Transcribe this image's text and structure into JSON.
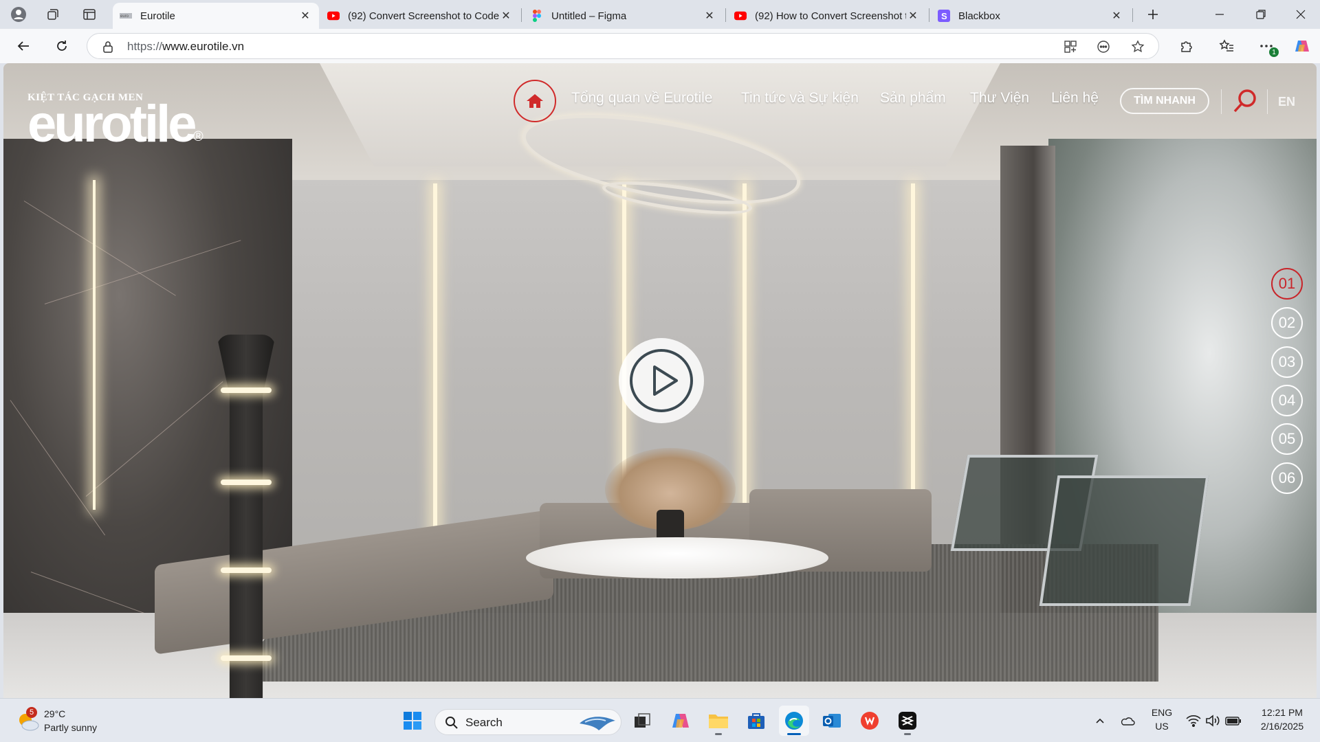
{
  "browser": {
    "tabs": [
      {
        "title": "Eurotile",
        "icon": "eurotile-favicon",
        "active": true
      },
      {
        "title": "(92) Convert Screenshot to Code",
        "icon": "youtube-favicon",
        "active": false
      },
      {
        "title": "Untitled – Figma",
        "icon": "figma-favicon",
        "active": false
      },
      {
        "title": "(92) How to Convert Screenshot t",
        "icon": "youtube-favicon",
        "active": false
      },
      {
        "title": "Blackbox",
        "icon": "blackbox-favicon",
        "active": false
      }
    ],
    "url_scheme": "https://",
    "url_host": "www.eurotile.vn",
    "extension_badge": "1"
  },
  "site": {
    "logo_tagline": "KIỆT TÁC GẠCH MEN",
    "logo_word": "eurotile",
    "logo_reg": "®",
    "nav": [
      {
        "label": "Tổng quan về Eurotile"
      },
      {
        "label": "Tin tức và Sự kiện"
      },
      {
        "label": "Sản phẩm"
      },
      {
        "label": "Thư Viện"
      },
      {
        "label": "Liên hệ"
      }
    ],
    "quick_search": "TÌM NHANH",
    "language": "EN",
    "slides": [
      "01",
      "02",
      "03",
      "04",
      "05",
      "06"
    ],
    "active_slide": "01",
    "accent": "#c8252a"
  },
  "taskbar": {
    "weather_temp": "29°C",
    "weather_condition": "Partly sunny",
    "weather_badge": "5",
    "search_label": "Search",
    "language_top": "ENG",
    "language_bottom": "US",
    "time": "12:21 PM",
    "date": "2/16/2025",
    "apps": [
      "windows-start-icon",
      "task-view-icon",
      "copilot-icon",
      "file-explorer-icon",
      "microsoft-store-icon",
      "edge-icon",
      "outlook-icon",
      "brave-icon",
      "capcut-icon"
    ]
  }
}
